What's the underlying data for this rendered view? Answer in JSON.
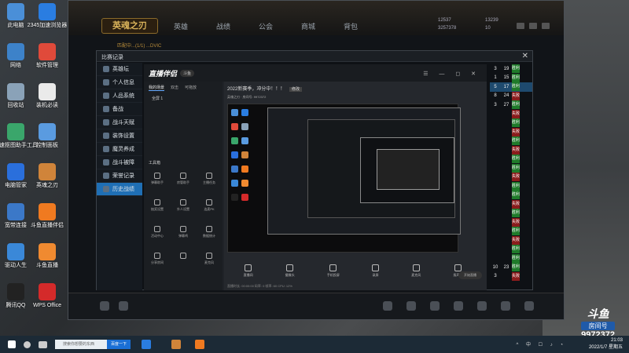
{
  "desktop_icons": [
    {
      "label": "此电脑",
      "color": "#4a8fd8"
    },
    {
      "label": "2345加速浏览器",
      "color": "#2a7de1"
    },
    {
      "label": "网络",
      "color": "#3d82c9"
    },
    {
      "label": "软件管理",
      "color": "#e04a3a"
    },
    {
      "label": "回收站",
      "color": "#8aa2b8"
    },
    {
      "label": "装机必读",
      "color": "#eaeaea"
    },
    {
      "label": "极速抠图助手工具",
      "color": "#3aa66b"
    },
    {
      "label": "控制面板",
      "color": "#5a9be0"
    },
    {
      "label": "电脑管家",
      "color": "#2a6fdc"
    },
    {
      "label": "英魂之刃",
      "color": "#d0843a"
    },
    {
      "label": "宽带连接",
      "color": "#3b78c8"
    },
    {
      "label": "斗鱼直播伴侣",
      "color": "#f07a20"
    },
    {
      "label": "驱动人生",
      "color": "#3a88d8"
    },
    {
      "label": "斗鱼直播",
      "color": "#f08a30"
    },
    {
      "label": "腾讯QQ",
      "color": "#222"
    },
    {
      "label": "WPS Office",
      "color": "#d42a2a"
    }
  ],
  "game": {
    "logo": "英魂之刃",
    "subtitle": "匹配中...(1/1) ...DVIC",
    "nav": [
      "英雄",
      "战绩",
      "公会",
      "商城",
      "背包"
    ],
    "res1": "12537",
    "res2": "3257378",
    "res3": "13239",
    "res4": "10"
  },
  "dialog": {
    "title": "比赛记录",
    "close": "✕",
    "sidebar": [
      "英雄坛",
      "个人信息",
      "人品系统",
      "备战",
      "战斗天赋",
      "装饰设置",
      "魔灵养成",
      "战斗被障",
      "荣誉记录",
      "历史战绩"
    ]
  },
  "stream_app": {
    "logo": "直播伴侣",
    "tag": "斗鱼",
    "tabs": [
      "我的场景",
      "双击",
      "可拖放"
    ],
    "scene": "全屏 1",
    "tools_label": "工具箱",
    "tools": [
      [
        "弹幕助手",
        "房管助手",
        "主播任务"
      ],
      [
        "抽奖设置",
        "外人设置",
        "连麦PK"
      ],
      [
        "活动中心",
        "弹幕鸡",
        "数据统计"
      ],
      [
        "分享房间",
        "",
        "麦克风"
      ]
    ],
    "title": "2022新赛季，冲分中！！！",
    "title_btn": "修改",
    "info": "英魂之刃 · 房间号: 9972372",
    "bottom_buttons": [
      "直播间",
      "摄像头",
      "手机投屏",
      "录屏",
      "麦克风",
      "扬声器"
    ],
    "status": "直播时长: 00:00:00   码率: 0   帧率: 60   CPU: 12%",
    "golive": "开始直播"
  },
  "results": [
    {
      "a": "3",
      "b": "19",
      "s": "胜利",
      "w": true
    },
    {
      "a": "1",
      "b": "15",
      "s": "胜利",
      "w": true
    },
    {
      "a": "5",
      "b": "17",
      "s": "胜利",
      "w": true,
      "hl": true
    },
    {
      "a": "8",
      "b": "24",
      "s": "失败",
      "w": false
    },
    {
      "a": "3",
      "b": "27",
      "s": "胜利",
      "w": true
    },
    {
      "a": "",
      "b": "",
      "s": "失败",
      "w": false
    },
    {
      "a": "",
      "b": "",
      "s": "胜利",
      "w": true
    },
    {
      "a": "",
      "b": "",
      "s": "失败",
      "w": false
    },
    {
      "a": "",
      "b": "",
      "s": "胜利",
      "w": true
    },
    {
      "a": "",
      "b": "",
      "s": "失败",
      "w": false
    },
    {
      "a": "",
      "b": "",
      "s": "胜利",
      "w": true
    },
    {
      "a": "",
      "b": "",
      "s": "胜利",
      "w": true
    },
    {
      "a": "",
      "b": "",
      "s": "失败",
      "w": false
    },
    {
      "a": "",
      "b": "",
      "s": "胜利",
      "w": true
    },
    {
      "a": "",
      "b": "",
      "s": "胜利",
      "w": true
    },
    {
      "a": "",
      "b": "",
      "s": "失败",
      "w": false
    },
    {
      "a": "",
      "b": "",
      "s": "胜利",
      "w": true
    },
    {
      "a": "",
      "b": "",
      "s": "失败",
      "w": false
    },
    {
      "a": "",
      "b": "",
      "s": "胜利",
      "w": true
    },
    {
      "a": "",
      "b": "",
      "s": "失败",
      "w": false
    },
    {
      "a": "",
      "b": "",
      "s": "胜利",
      "w": true
    },
    {
      "a": "",
      "b": "",
      "s": "胜利",
      "w": true
    },
    {
      "a": "10",
      "b": "23",
      "s": "胜利",
      "w": true
    },
    {
      "a": "3",
      "b": "",
      "s": "失败",
      "w": false
    }
  ],
  "watermark": {
    "brand": "斗鱼",
    "room_label": "房间号",
    "room": "9972372"
  },
  "taskbar": {
    "search_placeholder": "搜索你想要的东西",
    "search_button": "百度一下",
    "time": "21:03",
    "date": "2022/1/7 星期五",
    "tray": "^ 中 ☐ ♪ ◔"
  }
}
